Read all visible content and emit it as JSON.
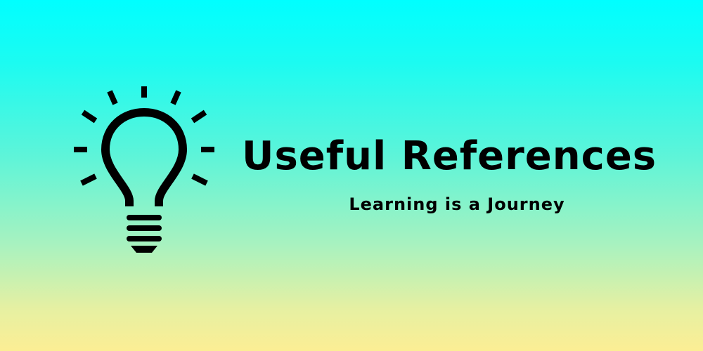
{
  "banner": {
    "icon": "lightbulb-icon",
    "title": "Useful References",
    "subtitle": "Learning is a Journey"
  },
  "colors": {
    "gradient_top": "#00ffff",
    "gradient_bottom": "#fcee94",
    "text": "#000000"
  }
}
